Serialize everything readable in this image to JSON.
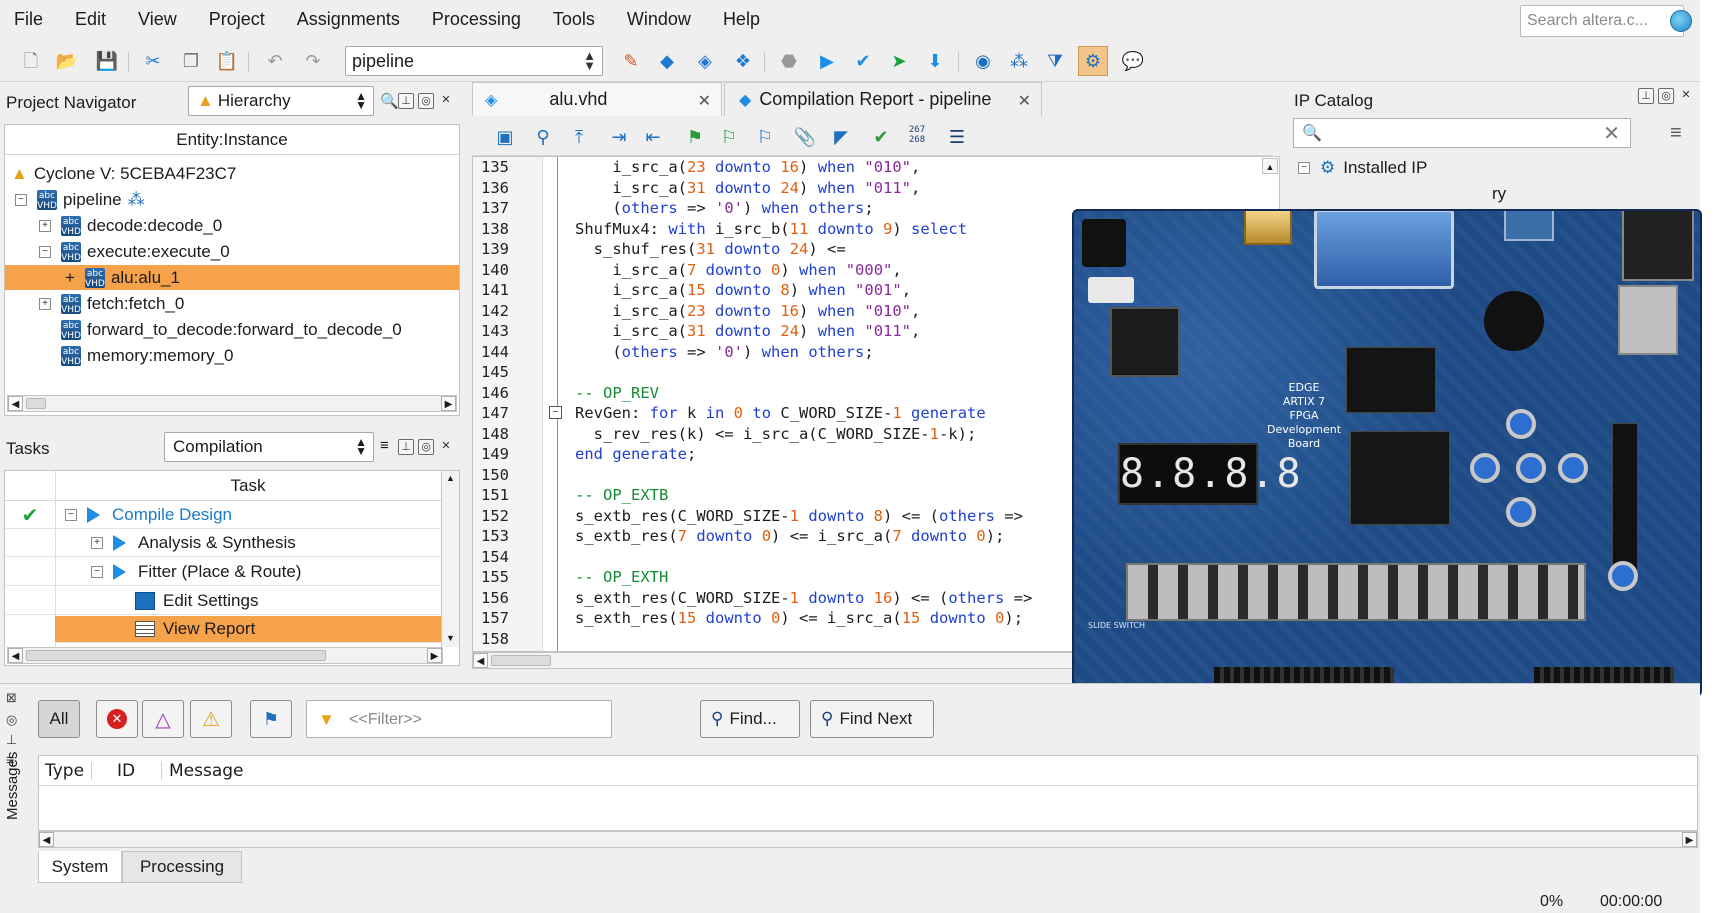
{
  "menu": [
    "File",
    "Edit",
    "View",
    "Project",
    "Assignments",
    "Processing",
    "Tools",
    "Window",
    "Help"
  ],
  "search": {
    "placeholder": "Search altera.c..."
  },
  "toolbar": {
    "revision": "pipeline"
  },
  "project_navigator": {
    "title": "Project Navigator",
    "view": "Hierarchy",
    "column": "Entity:Instance",
    "device": "Cyclone V: 5CEBA4F23C7",
    "top": "pipeline",
    "items": [
      "decode:decode_0",
      "execute:execute_0",
      "alu:alu_1",
      "fetch:fetch_0",
      "forward_to_decode:forward_to_decode_0",
      "memory:memory_0"
    ],
    "selected": "alu:alu_1"
  },
  "tasks": {
    "title": "Tasks",
    "flow": "Compilation",
    "column": "Task",
    "rows": [
      "Compile Design",
      "Analysis & Synthesis",
      "Fitter (Place & Route)",
      "Edit Settings",
      "View Report"
    ]
  },
  "editor": {
    "tabs": [
      "alu.vhd",
      "Compilation Report - pipeline"
    ],
    "line_numbers": [
      "135",
      "136",
      "137",
      "138",
      "139",
      "140",
      "141",
      "142",
      "143",
      "144",
      "145",
      "146",
      "147",
      "148",
      "149",
      "150",
      "151",
      "152",
      "153",
      "154",
      "155",
      "156",
      "157",
      "158"
    ]
  },
  "ip_catalog": {
    "title": "IP Catalog",
    "installed": "Installed IP",
    "partial_item": "ry"
  },
  "board": {
    "labels": [
      "EDGE",
      "ARTIX 7",
      "FPGA",
      "Development",
      "Board"
    ],
    "display": "8.8.8.8",
    "foot_label": "SLIDE SWITCH"
  },
  "messages": {
    "filters": {
      "all": "All"
    },
    "filter_placeholder": "<<Filter>>",
    "find": "Find...",
    "find_next": "Find Next",
    "columns": [
      "Type",
      "ID",
      "Message"
    ],
    "tabs": [
      "System",
      "Processing"
    ],
    "side_label": "Messages"
  },
  "status": {
    "progress": "0%",
    "time": "00:00:00"
  },
  "colors": {
    "selection": "#f5a24a",
    "keyword": "#1f3fd0",
    "number": "#e06010",
    "string": "#8a2aa0",
    "comment": "#168a33",
    "board": "#1e4b86"
  }
}
